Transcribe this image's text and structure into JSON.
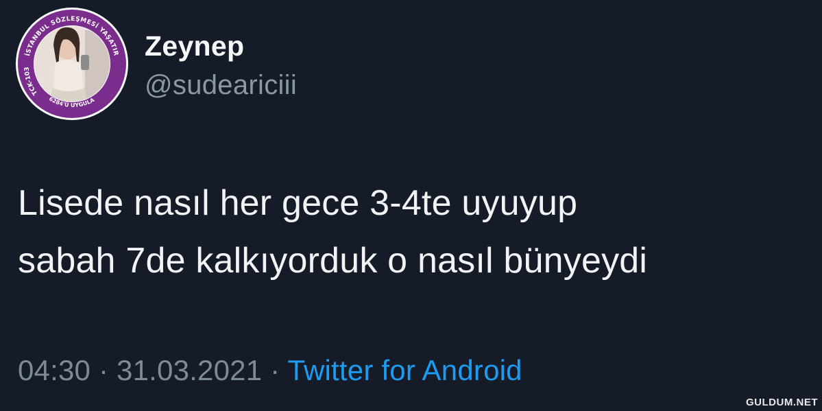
{
  "author": {
    "display_name": "Zeynep",
    "handle": "@sudeariciii",
    "avatar_ring_texts": {
      "top": "İSTANBUL SÖZLEŞMESİ YAŞATIR",
      "left": "TCK-103",
      "bottom": "6284'Ü UYGULA"
    }
  },
  "tweet": {
    "lines": [
      "Lisede nasıl her gece 3-4te uyuyup",
      "sabah 7de kalkıyorduk o nasıl bünyeydi"
    ],
    "time": "04:30",
    "separator_1": " · ",
    "date": "31.03.2021",
    "separator_2": " · ",
    "source": "Twitter for Android"
  },
  "watermark": "GULDUM.NET",
  "colors": {
    "background": "#151c28",
    "text": "#f1f3f5",
    "muted": "#7d8a97",
    "link": "#1d9bf0",
    "avatar_ring": "#7b2d8e"
  }
}
